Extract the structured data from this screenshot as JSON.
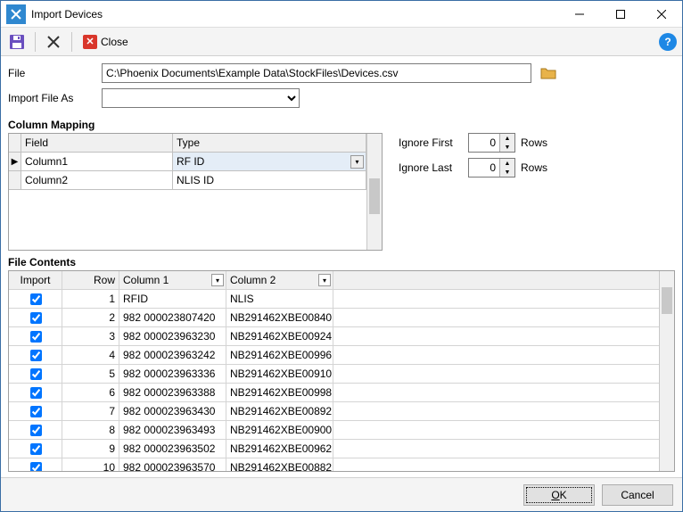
{
  "window": {
    "title": "Import Devices"
  },
  "toolbar": {
    "close_label": "Close"
  },
  "form": {
    "file_label": "File",
    "file_value": "C:\\Phoenix Documents\\Example Data\\StockFiles\\Devices.csv",
    "import_as_label": "Import File As",
    "import_as_value": ""
  },
  "mapping": {
    "title": "Column Mapping",
    "headers": {
      "field": "Field",
      "type": "Type"
    },
    "rows": [
      {
        "field": "Column1",
        "type": "RF ID",
        "selected": true
      },
      {
        "field": "Column2",
        "type": "NLIS ID",
        "selected": false
      }
    ]
  },
  "ignore": {
    "first_label": "Ignore First",
    "last_label": "Ignore Last",
    "rows_label": "Rows",
    "first_value": "0",
    "last_value": "0"
  },
  "filecontents": {
    "title": "File Contents",
    "headers": {
      "import": "Import",
      "row": "Row",
      "col1": "Column 1",
      "col2": "Column 2"
    },
    "rows": [
      {
        "import": true,
        "row": "1",
        "col1": "RFID",
        "col2": "NLIS"
      },
      {
        "import": true,
        "row": "2",
        "col1": "982 000023807420",
        "col2": "NB291462XBE00840"
      },
      {
        "import": true,
        "row": "3",
        "col1": "982 000023963230",
        "col2": "NB291462XBE00924"
      },
      {
        "import": true,
        "row": "4",
        "col1": "982 000023963242",
        "col2": "NB291462XBE00996"
      },
      {
        "import": true,
        "row": "5",
        "col1": "982 000023963336",
        "col2": "NB291462XBE00910"
      },
      {
        "import": true,
        "row": "6",
        "col1": "982 000023963388",
        "col2": "NB291462XBE00998"
      },
      {
        "import": true,
        "row": "7",
        "col1": "982 000023963430",
        "col2": "NB291462XBE00892"
      },
      {
        "import": true,
        "row": "8",
        "col1": "982 000023963493",
        "col2": "NB291462XBE00900"
      },
      {
        "import": true,
        "row": "9",
        "col1": "982 000023963502",
        "col2": "NB291462XBE00962"
      },
      {
        "import": true,
        "row": "10",
        "col1": "982 000023963570",
        "col2": "NB291462XBE00882"
      }
    ]
  },
  "buttons": {
    "ok": "OK",
    "cancel": "Cancel"
  }
}
